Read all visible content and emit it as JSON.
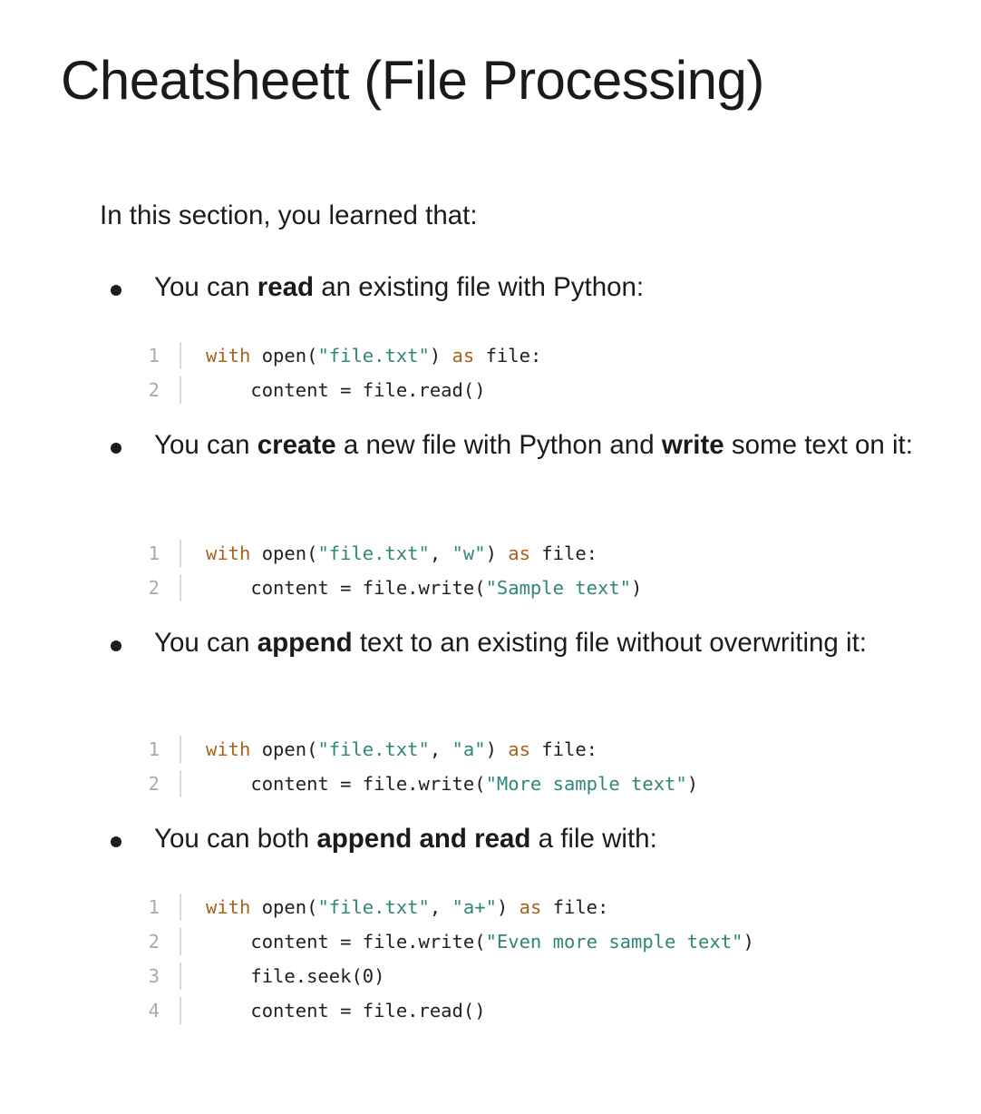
{
  "title": "Cheatsheett (File Processing)",
  "intro": "In this section, you learned that:",
  "bullets": [
    {
      "segments": [
        {
          "text": "You can ",
          "bold": false
        },
        {
          "text": "read",
          "bold": true
        },
        {
          "text": " an existing file with Python:",
          "bold": false
        }
      ],
      "code": [
        {
          "num": "1",
          "tokens": [
            {
              "t": "with",
              "c": "kw"
            },
            {
              "t": " open(",
              "c": ""
            },
            {
              "t": "\"file.txt\"",
              "c": "str"
            },
            {
              "t": ") ",
              "c": ""
            },
            {
              "t": "as",
              "c": "kw"
            },
            {
              "t": " file:",
              "c": ""
            }
          ]
        },
        {
          "num": "2",
          "tokens": [
            {
              "t": "    content = file.read()",
              "c": ""
            }
          ]
        }
      ]
    },
    {
      "segments": [
        {
          "text": "You can ",
          "bold": false
        },
        {
          "text": "create",
          "bold": true
        },
        {
          "text": " a new file with Python and ",
          "bold": false
        },
        {
          "text": "write",
          "bold": true
        },
        {
          "text": " some text on it:",
          "bold": false
        }
      ],
      "code": [
        {
          "num": "1",
          "tokens": [
            {
              "t": "with",
              "c": "kw"
            },
            {
              "t": " open(",
              "c": ""
            },
            {
              "t": "\"file.txt\"",
              "c": "str"
            },
            {
              "t": ", ",
              "c": ""
            },
            {
              "t": "\"w\"",
              "c": "str"
            },
            {
              "t": ") ",
              "c": ""
            },
            {
              "t": "as",
              "c": "kw"
            },
            {
              "t": " file:",
              "c": ""
            }
          ]
        },
        {
          "num": "2",
          "tokens": [
            {
              "t": "    content = file.write(",
              "c": ""
            },
            {
              "t": "\"Sample text\"",
              "c": "str"
            },
            {
              "t": ")",
              "c": ""
            }
          ]
        }
      ]
    },
    {
      "segments": [
        {
          "text": "You can ",
          "bold": false
        },
        {
          "text": "append",
          "bold": true
        },
        {
          "text": " text to an existing file without overwriting it:",
          "bold": false
        }
      ],
      "code": [
        {
          "num": "1",
          "tokens": [
            {
              "t": "with",
              "c": "kw"
            },
            {
              "t": " open(",
              "c": ""
            },
            {
              "t": "\"file.txt\"",
              "c": "str"
            },
            {
              "t": ", ",
              "c": ""
            },
            {
              "t": "\"a\"",
              "c": "str"
            },
            {
              "t": ") ",
              "c": ""
            },
            {
              "t": "as",
              "c": "kw"
            },
            {
              "t": " file:",
              "c": ""
            }
          ]
        },
        {
          "num": "2",
          "tokens": [
            {
              "t": "    content = file.write(",
              "c": ""
            },
            {
              "t": "\"More sample text\"",
              "c": "str"
            },
            {
              "t": ")",
              "c": ""
            }
          ]
        }
      ]
    },
    {
      "segments": [
        {
          "text": "You can both ",
          "bold": false
        },
        {
          "text": "append and read",
          "bold": true
        },
        {
          "text": " a file with:",
          "bold": false
        }
      ],
      "code": [
        {
          "num": "1",
          "tokens": [
            {
              "t": "with",
              "c": "kw"
            },
            {
              "t": " open(",
              "c": ""
            },
            {
              "t": "\"file.txt\"",
              "c": "str"
            },
            {
              "t": ", ",
              "c": ""
            },
            {
              "t": "\"a+\"",
              "c": "str"
            },
            {
              "t": ") ",
              "c": ""
            },
            {
              "t": "as",
              "c": "kw"
            },
            {
              "t": " file:",
              "c": ""
            }
          ]
        },
        {
          "num": "2",
          "tokens": [
            {
              "t": "    content = file.write(",
              "c": ""
            },
            {
              "t": "\"Even more sample text\"",
              "c": "str"
            },
            {
              "t": ")",
              "c": ""
            }
          ]
        },
        {
          "num": "3",
          "tokens": [
            {
              "t": "    file.seek(0)",
              "c": ""
            }
          ]
        },
        {
          "num": "4",
          "tokens": [
            {
              "t": "    content = file.read()",
              "c": ""
            }
          ]
        }
      ]
    }
  ]
}
